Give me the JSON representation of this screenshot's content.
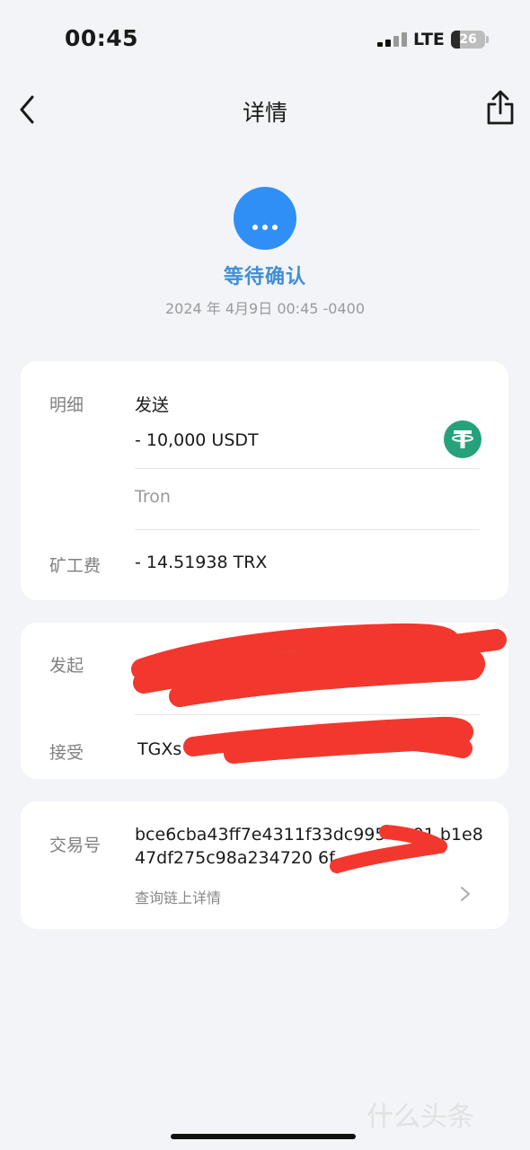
{
  "status_bar": {
    "time": "00:45",
    "network": "LTE",
    "battery": "26"
  },
  "nav": {
    "title": "详情"
  },
  "status": {
    "text": "等待确认",
    "timestamp": "2024 年 4月9日 00:45 -0400"
  },
  "detail_card": {
    "detail_label": "明细",
    "type": "发送",
    "amount": "- 10,000 USDT",
    "network": "Tron",
    "fee_label": "矿工费",
    "fee": "- 14.51938 TRX"
  },
  "address_card": {
    "from_label": "发起",
    "from_value": "",
    "to_label": "接受",
    "to_value": "TGXs"
  },
  "tx_card": {
    "tx_label": "交易号",
    "tx_hash": "bce6cba43ff7e4311f33dc995 5891 b1e847df275c98a234720 6f",
    "view_on_chain": "查询链上详情"
  },
  "watermark": "什么头条",
  "colors": {
    "accent": "#2f8ff5",
    "status_text": "#3f8fd6",
    "usdt": "#26a17b",
    "redaction": "#f2382e"
  }
}
